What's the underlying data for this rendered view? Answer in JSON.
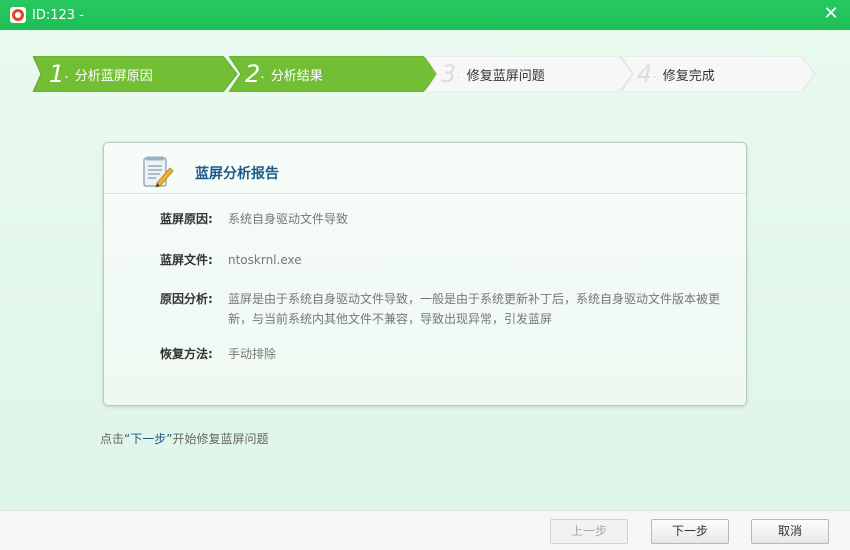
{
  "window": {
    "title": "ID:123 -",
    "close_glyph": "✕"
  },
  "steps": [
    {
      "num": "1",
      "label": "分析蓝屏原因",
      "state": "active"
    },
    {
      "num": "2",
      "label": "分析结果",
      "state": "active"
    },
    {
      "num": "3",
      "label": "修复蓝屏问题",
      "state": "inactive"
    },
    {
      "num": "4",
      "label": "修复完成",
      "state": "inactive"
    }
  ],
  "report": {
    "title": "蓝屏分析报告",
    "rows": [
      {
        "key": "蓝屏原因:",
        "value": "系统自身驱动文件导致"
      },
      {
        "key": "蓝屏文件:",
        "value": "ntoskrnl.exe"
      },
      {
        "key": "原因分析:",
        "value": "蓝屏是由于系统自身驱动文件导致，一般是由于系统更新补丁后，系统自身驱动文件版本被更新，与当前系统内其他文件不兼容，导致出现异常，引发蓝屏"
      },
      {
        "key": "恢复方法:",
        "value": "手动排除"
      }
    ]
  },
  "hint": {
    "prefix": "点击",
    "link": "“下一步”",
    "suffix": "开始修复蓝屏问题"
  },
  "buttons": {
    "prev": "上一步",
    "next": "下一步",
    "cancel": "取消"
  },
  "colors": {
    "titlebar": "#22c55e",
    "step_active": "#72bf36",
    "step_inactive": "#f7f7f7",
    "link": "#1d5a8a"
  },
  "icons": {
    "app": "lifebuoy-icon",
    "report": "document-pencil-icon"
  }
}
